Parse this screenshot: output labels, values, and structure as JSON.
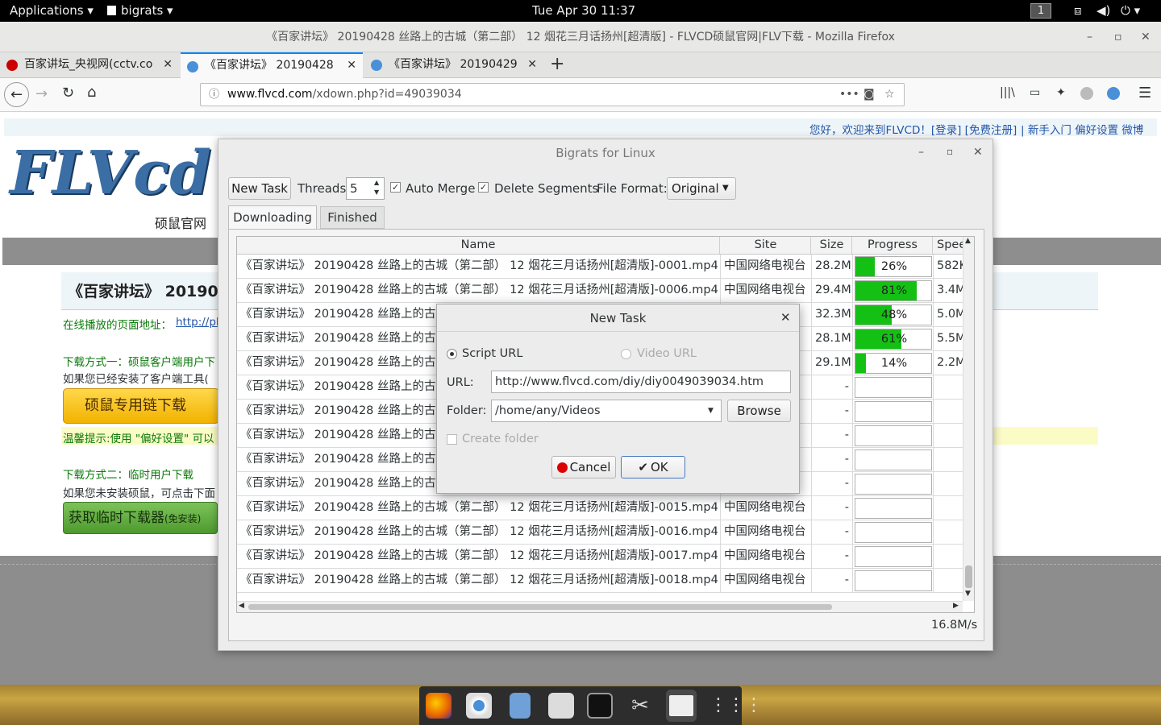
{
  "topbar": {
    "applications": "Applications ▾",
    "app": "bigrats ▾",
    "clock": "Tue Apr 30  11:37",
    "workspace": "1"
  },
  "firefox": {
    "title": "《百家讲坛》 20190428 丝路上的古城（第二部） 12 烟花三月话扬州[超清版] - FLVCD硕鼠官网|FLV下载 - Mozilla Firefox",
    "tabs": [
      "百家讲坛_央视网(cctv.co",
      "《百家讲坛》 20190428",
      "《百家讲坛》 20190429"
    ],
    "url_host": "www.flvcd.com",
    "url_path": "/xdown.php?id=49039034"
  },
  "site": {
    "welcome": "您好，欢迎来到FLVCD！[登录] [免费注册]",
    "links": "| 新手入门   偏好设置   微博",
    "logo": "FLVcd",
    "logo_sub": "硕鼠官网",
    "heading": "《百家讲坛》 201904",
    "play_label": "在线播放的页面地址：",
    "play_link": "http://pla",
    "method1": "下载方式一：硕鼠客户端用户下",
    "method1_note": "如果您已经安装了客户端工具(",
    "btn1": "硕鼠专用链下载",
    "tip": "温馨提示:使用 \"偏好设置\" 可以",
    "method2": "下载方式二：临时用户下载",
    "method2_note": "如果您未安装硕鼠，可点击下面",
    "btn2": "获取临时下载器",
    "btn2_small": "(免安装)"
  },
  "bigrats": {
    "title": "Bigrats for Linux",
    "new_task": "New Task",
    "threads_label": "Threads",
    "threads_value": "5",
    "auto_merge": "Auto Merge",
    "delete_segments": "Delete Segments",
    "file_format_label": "File Format:",
    "file_format": "Original",
    "tab_downloading": "Downloading",
    "tab_finished": "Finished",
    "columns": [
      "Name",
      "Site",
      "Size",
      "Progress",
      "Spee"
    ],
    "rows": [
      {
        "name": "《百家讲坛》 20190428 丝路上的古城（第二部） 12 烟花三月话扬州[超清版]-0001.mp4",
        "site": "中国网络电视台",
        "size": "28.2M",
        "progress": 26,
        "plabel": "26%",
        "speed": "582K"
      },
      {
        "name": "《百家讲坛》 20190428 丝路上的古城（第二部） 12 烟花三月话扬州[超清版]-0006.mp4",
        "site": "中国网络电视台",
        "size": "29.4M",
        "progress": 81,
        "plabel": "81%",
        "speed": "3.4M"
      },
      {
        "name": "《百家讲坛》 20190428 丝路上的古城",
        "site": "台",
        "size": "32.3M",
        "progress": 48,
        "plabel": "48%",
        "speed": "5.0M"
      },
      {
        "name": "《百家讲坛》 20190428 丝路上的古城",
        "site": "台",
        "size": "28.1M",
        "progress": 61,
        "plabel": "61%",
        "speed": "5.5M"
      },
      {
        "name": "《百家讲坛》 20190428 丝路上的古城",
        "site": "台",
        "size": "29.1M",
        "progress": 14,
        "plabel": "14%",
        "speed": "2.2M"
      },
      {
        "name": "《百家讲坛》 20190428 丝路上的古城",
        "site": "台",
        "size": "-",
        "progress": null,
        "plabel": "",
        "speed": ""
      },
      {
        "name": "《百家讲坛》 20190428 丝路上的古城",
        "site": "台",
        "size": "-",
        "progress": null,
        "plabel": "",
        "speed": ""
      },
      {
        "name": "《百家讲坛》 20190428 丝路上的古城",
        "site": "台",
        "size": "-",
        "progress": null,
        "plabel": "",
        "speed": ""
      },
      {
        "name": "《百家讲坛》 20190428 丝路上的古城",
        "site": "台",
        "size": "-",
        "progress": null,
        "plabel": "",
        "speed": ""
      },
      {
        "name": "《百家讲坛》 20190428 丝路上的古城",
        "site": "台",
        "size": "-",
        "progress": null,
        "plabel": "",
        "speed": ""
      },
      {
        "name": "《百家讲坛》 20190428 丝路上的古城（第二部） 12 烟花三月话扬州[超清版]-0015.mp4",
        "site": "中国网络电视台",
        "size": "-",
        "progress": null,
        "plabel": "",
        "speed": ""
      },
      {
        "name": "《百家讲坛》 20190428 丝路上的古城（第二部） 12 烟花三月话扬州[超清版]-0016.mp4",
        "site": "中国网络电视台",
        "size": "-",
        "progress": null,
        "plabel": "",
        "speed": ""
      },
      {
        "name": "《百家讲坛》 20190428 丝路上的古城（第二部） 12 烟花三月话扬州[超清版]-0017.mp4",
        "site": "中国网络电视台",
        "size": "-",
        "progress": null,
        "plabel": "",
        "speed": ""
      },
      {
        "name": "《百家讲坛》 20190428 丝路上的古城（第二部） 12 烟花三月话扬州[超清版]-0018.mp4",
        "site": "中国网络电视台",
        "size": "-",
        "progress": null,
        "plabel": "",
        "speed": ""
      }
    ],
    "total_speed": "16.8M/s"
  },
  "dialog": {
    "title": "New Task",
    "script_url": "Script URL",
    "video_url": "Video URL",
    "url_label": "URL:",
    "url_value": "http://www.flvcd.com/diy/diy0049039034.htm",
    "folder_label": "Folder:",
    "folder_value": "/home/any/Videos",
    "browse": "Browse",
    "create_folder": "Create folder",
    "cancel": "Cancel",
    "ok": "OK"
  },
  "colors": {
    "progress": "#15c015",
    "accent": "#0a84ff",
    "site_link": "#2456a8"
  }
}
